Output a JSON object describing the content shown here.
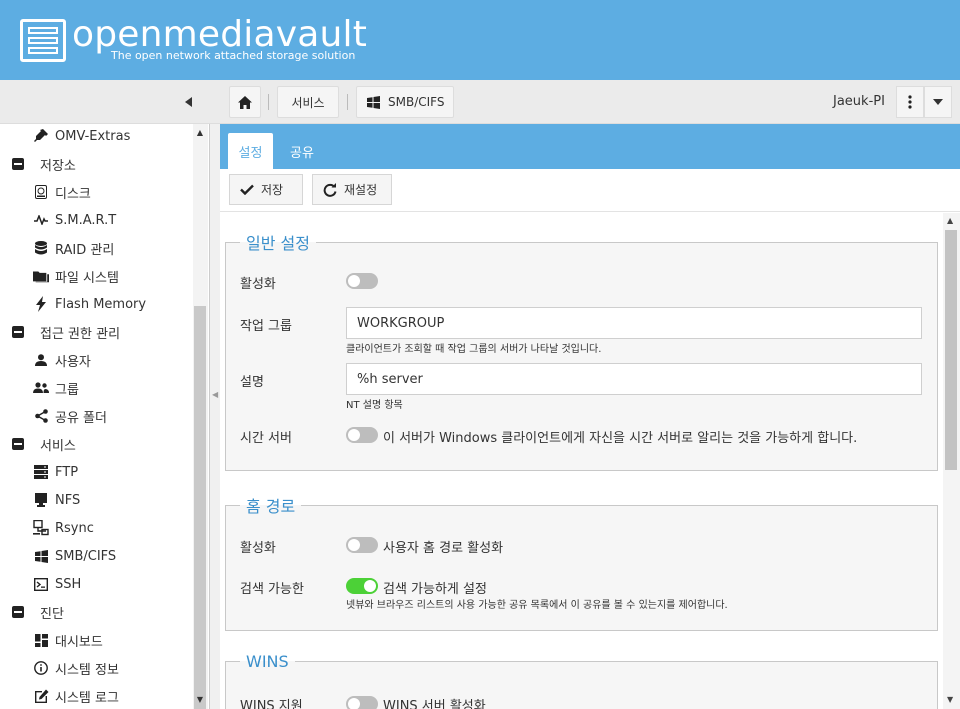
{
  "header": {
    "title": "openmediavault",
    "subtitle": "The open network attached storage solution"
  },
  "toolbar": {
    "breadcrumbs": [
      {
        "label": "",
        "icon": "home-icon"
      },
      {
        "label": "서비스"
      },
      {
        "label": "SMB/CIFS",
        "icon": "windows-icon"
      }
    ],
    "hostname": "Jaeuk-PI"
  },
  "sidebar": {
    "items": [
      {
        "label": "OMV-Extras",
        "icon": "plug-icon",
        "type": "child"
      },
      {
        "label": "저장소",
        "type": "group"
      },
      {
        "label": "디스크",
        "icon": "disk-icon",
        "type": "child"
      },
      {
        "label": "S.M.A.R.T",
        "icon": "pulse-icon",
        "type": "child"
      },
      {
        "label": "RAID 관리",
        "icon": "database-icon",
        "type": "child"
      },
      {
        "label": "파일 시스템",
        "icon": "folders-icon",
        "type": "child"
      },
      {
        "label": "Flash Memory",
        "icon": "bolt-icon",
        "type": "child"
      },
      {
        "label": "접근 권한 관리",
        "type": "group"
      },
      {
        "label": "사용자",
        "icon": "user-icon",
        "type": "child"
      },
      {
        "label": "그룹",
        "icon": "group-icon",
        "type": "child"
      },
      {
        "label": "공유 폴더",
        "icon": "share-icon",
        "type": "child"
      },
      {
        "label": "서비스",
        "type": "group"
      },
      {
        "label": "FTP",
        "icon": "server-icon",
        "type": "child"
      },
      {
        "label": "NFS",
        "icon": "monitor-icon",
        "type": "child"
      },
      {
        "label": "Rsync",
        "icon": "network-icon",
        "type": "child"
      },
      {
        "label": "SMB/CIFS",
        "icon": "windows-icon",
        "type": "child"
      },
      {
        "label": "SSH",
        "icon": "terminal-icon",
        "type": "child"
      },
      {
        "label": "진단",
        "type": "group"
      },
      {
        "label": "대시보드",
        "icon": "dashboard-icon",
        "type": "child"
      },
      {
        "label": "시스템 정보",
        "icon": "info-icon",
        "type": "child"
      },
      {
        "label": "시스템 로그",
        "icon": "edit-icon",
        "type": "child"
      }
    ]
  },
  "tabs": {
    "settings": "설정",
    "shares": "공유"
  },
  "actions": {
    "save": "저장",
    "reset": "재설정"
  },
  "general": {
    "legend": "일반 설정",
    "enable_label": "활성화",
    "enable_on": false,
    "workgroup_label": "작업 그룹",
    "workgroup_value": "WORKGROUP",
    "workgroup_hint": "클라이언트가 조회할 때 작업 그룹의 서버가 나타날 것입니다.",
    "desc_label": "설명",
    "desc_value": "%h server",
    "desc_hint": "NT 설명 항목",
    "timeserver_label": "시간 서버",
    "timeserver_on": false,
    "timeserver_text": "이 서버가 Windows 클라이언트에게 자신을 시간 서버로 알리는 것을 가능하게 합니다."
  },
  "homes": {
    "legend": "홈 경로",
    "enable_label": "활성화",
    "enable_on": false,
    "enable_text": "사용자 홈 경로 활성화",
    "browse_label": "검색 가능한",
    "browse_on": true,
    "browse_text": "검색 가능하게 설정",
    "browse_hint": "넷뷰와 브라우즈 리스트의 사용 가능한 공유 목록에서 이 공유를 볼 수 있는지를 제어합니다."
  },
  "wins": {
    "legend": "WINS",
    "support_label": "WINS 지원",
    "support_on": false,
    "support_text": "WINS 서버 활성화"
  },
  "colors": {
    "accent": "#5dade2",
    "legend": "#3a8fcb",
    "toggle_on": "#4cd137"
  }
}
